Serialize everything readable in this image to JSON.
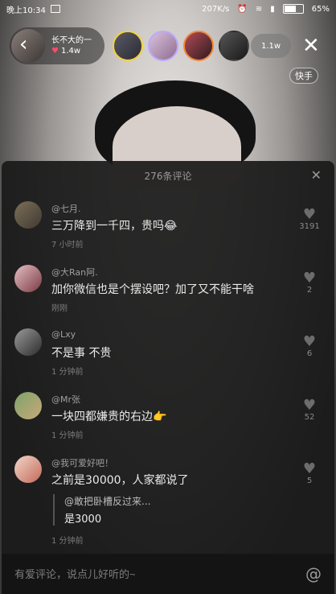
{
  "status_bar": {
    "time": "晚上10:34",
    "network_speed": "207K/s",
    "battery": "65%",
    "battery_level": 0.65
  },
  "host": {
    "name": "长不大的一",
    "likes": "1.4w"
  },
  "audience": {
    "count": "1.1w"
  },
  "badge": "快手",
  "comments_panel": {
    "title": "276条评论",
    "comments": [
      {
        "name": "@七月.",
        "text": "三万降到一千四，贵吗😂",
        "time": "7 小时前",
        "likes": "3191"
      },
      {
        "name": "@大Ran阿.",
        "text": "加你微信也是个摆设吧？加了又不能干啥",
        "time": "刚刚",
        "likes": "2"
      },
      {
        "name": "@Lxy",
        "text": "不是事 不贵",
        "time": "1 分钟前",
        "likes": "6"
      },
      {
        "name": "@Mr张",
        "text": "一块四都嫌贵的右边👉",
        "time": "1 分钟前",
        "likes": "52"
      },
      {
        "name": "@我可爱好吧！",
        "text": "之前是30000，人家都说了",
        "time": "1 分钟前",
        "likes": "5",
        "reply_name": "@敢把卧槽反过来...",
        "reply_text": "是3000"
      }
    ]
  },
  "input": {
    "placeholder": "有爱评论，说点儿好听的~"
  },
  "colors": {
    "heart_active": "#ff4a6b",
    "panel_bg": "#1a1a1a"
  }
}
